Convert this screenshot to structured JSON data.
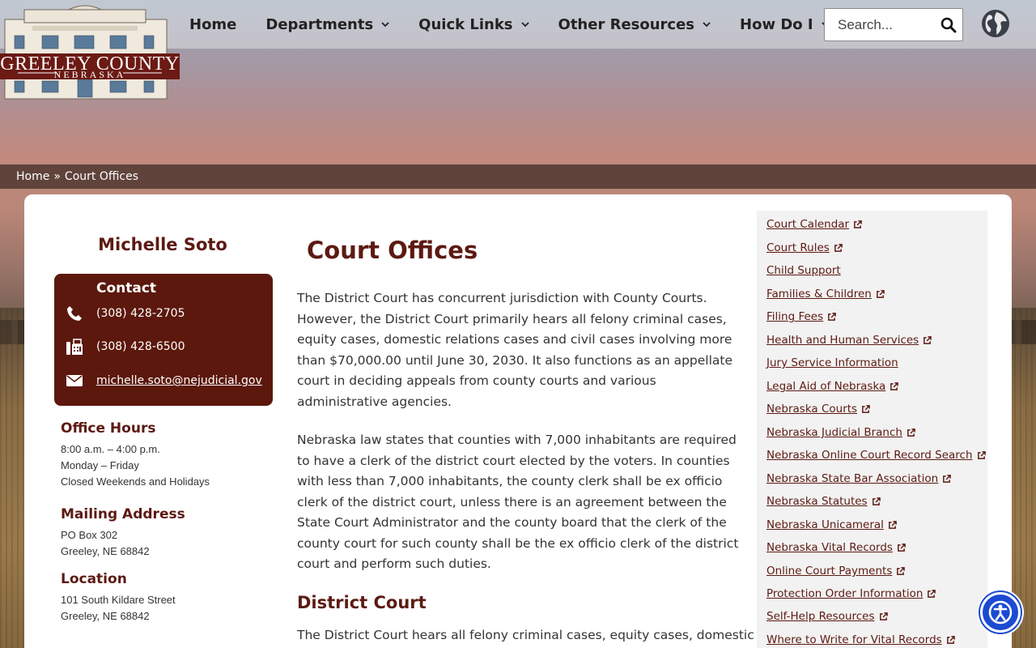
{
  "header": {
    "logo": {
      "line1": "GREELEY COUNTY",
      "line2": "NEBRASKA"
    },
    "nav": [
      {
        "label": "Home",
        "dropdown": false
      },
      {
        "label": "Departments",
        "dropdown": true
      },
      {
        "label": "Quick Links",
        "dropdown": true
      },
      {
        "label": "Other Resources",
        "dropdown": true
      },
      {
        "label": "How Do I",
        "dropdown": true
      }
    ],
    "search": {
      "placeholder": "Search..."
    }
  },
  "breadcrumb": {
    "home": "Home",
    "separator": "»",
    "current": "Court Offices"
  },
  "sidebar": {
    "person_name": "Michelle Soto",
    "contact": {
      "title": "Contact",
      "phone": "(308) 428-2705",
      "fax": "(308) 428-6500",
      "email": "michelle.soto@nejudicial.gov"
    },
    "office_hours": {
      "heading": "Office Hours",
      "lines": [
        "8:00 a.m. – 4:00 p.m.",
        "Monday – Friday",
        "Closed Weekends and Holidays"
      ]
    },
    "mailing_address": {
      "heading": "Mailing Address",
      "lines": [
        "PO Box 302",
        "Greeley, NE 68842"
      ]
    },
    "location": {
      "heading": "Location",
      "lines": [
        "101 South Kildare Street",
        "Greeley, NE 68842"
      ]
    }
  },
  "main": {
    "title": "Court Offices",
    "paragraphs": [
      "The District Court has concurrent jurisdiction with County Courts. However, the District Court primarily hears all felony criminal cases, equity cases, domestic relations cases and civil cases involving more than $70,000.00 until June 30, 2030. It also functions as an appellate court in deciding appeals from county courts and various administrative agencies.",
      "Nebraska law states that counties with 7,000 inhabitants are required to have a clerk of the district court elected by the voters.  In counties with less than 7,000 inhabitants, the county clerk shall be ex officio clerk of the district court, unless there is an agreement between the State Court Administrator and the county board that the clerk of the county court for such county shall be the ex officio clerk of the district court and perform such duties."
    ],
    "subheading": "District Court",
    "sub_paragraph": "The District Court hears all felony criminal cases, equity cases, domestic"
  },
  "links": [
    {
      "label": "Court Calendar",
      "external": true
    },
    {
      "label": "Court Rules",
      "external": true
    },
    {
      "label": "Child Support",
      "external": false
    },
    {
      "label": "Families & Children",
      "external": true
    },
    {
      "label": "Filing Fees",
      "external": true
    },
    {
      "label": "Health and Human Services",
      "external": true
    },
    {
      "label": "Jury Service Information",
      "external": false
    },
    {
      "label": "Legal Aid of Nebraska",
      "external": true
    },
    {
      "label": "Nebraska Courts",
      "external": true
    },
    {
      "label": "Nebraska Judicial Branch",
      "external": true
    },
    {
      "label": "Nebraska Online Court Record Search",
      "external": true
    },
    {
      "label": "Nebraska State Bar Association",
      "external": true
    },
    {
      "label": "Nebraska Statutes",
      "external": true
    },
    {
      "label": "Nebraska Unicameral",
      "external": true
    },
    {
      "label": "Nebraska Vital Records",
      "external": true
    },
    {
      "label": "Online Court Payments",
      "external": true
    },
    {
      "label": "Protection Order Information",
      "external": true
    },
    {
      "label": "Self-Help Resources",
      "external": true
    },
    {
      "label": "Where to Write for Vital Records",
      "external": true
    }
  ],
  "colors": {
    "brand_maroon": "#5c1a12",
    "contact_bg": "#5c180c",
    "accessibility_blue": "#1c4bd2"
  },
  "icons": [
    "phone-icon",
    "fax-icon",
    "email-icon",
    "search-icon",
    "globe-icon",
    "external-link-icon",
    "chevron-down-icon",
    "accessibility-icon"
  ]
}
